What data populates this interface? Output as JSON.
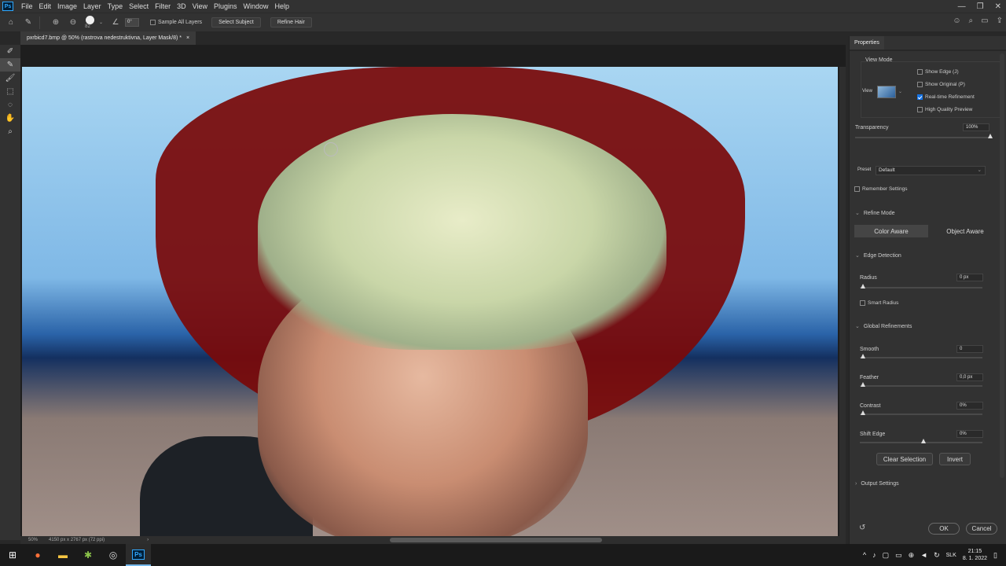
{
  "app": {
    "logo": "Ps"
  },
  "menu": [
    "File",
    "Edit",
    "Image",
    "Layer",
    "Type",
    "Select",
    "Filter",
    "3D",
    "View",
    "Plugins",
    "Window",
    "Help"
  ],
  "window_controls": [
    "—",
    "❐",
    "✕"
  ],
  "options": {
    "brush_size": "82",
    "angle_value": "0°",
    "sample_all_layers": "Sample All Layers",
    "select_subject": "Select Subject",
    "refine_hair": "Refine Hair"
  },
  "document": {
    "tab_title": "pxrbicd7.bmp @ 50% (rastrova nedestruktivna, Layer Mask/8) *",
    "tab_close": "×"
  },
  "status": {
    "zoom": "50%",
    "dimensions": "4150 px x 2767 px (72 ppi)",
    "arrow": "›"
  },
  "properties": {
    "tab_label": "Properties",
    "view_mode": {
      "label": "View Mode",
      "view_label": "View",
      "show_edge": "Show Edge (J)",
      "show_original": "Show Original (P)",
      "realtime_refinement": "Real-time Refinement",
      "high_quality_preview": "High Quality Preview"
    },
    "transparency": {
      "label": "Transparency",
      "value": "100%",
      "level": 1.0
    },
    "preset": {
      "label": "Preset",
      "value": "Default"
    },
    "remember_settings": "Remember Settings",
    "refine_mode": {
      "label": "Refine Mode",
      "color_aware": "Color Aware",
      "object_aware": "Object Aware"
    },
    "edge_detection": {
      "label": "Edge Detection",
      "radius_label": "Radius",
      "radius_value": "0 px",
      "smart_radius": "Smart Radius"
    },
    "global_refinements": {
      "label": "Global Refinements",
      "smooth_label": "Smooth",
      "smooth_value": "0",
      "feather_label": "Feather",
      "feather_value": "0,0 px",
      "contrast_label": "Contrast",
      "contrast_value": "0%",
      "shift_edge_label": "Shift Edge",
      "shift_edge_value": "0%"
    },
    "clear_selection": "Clear Selection",
    "invert": "Invert",
    "output_settings": "Output Settings",
    "ok": "OK",
    "cancel": "Cancel"
  },
  "taskbar": {
    "language": "SLK",
    "time": "21:15",
    "date": "8. 1. 2022"
  }
}
